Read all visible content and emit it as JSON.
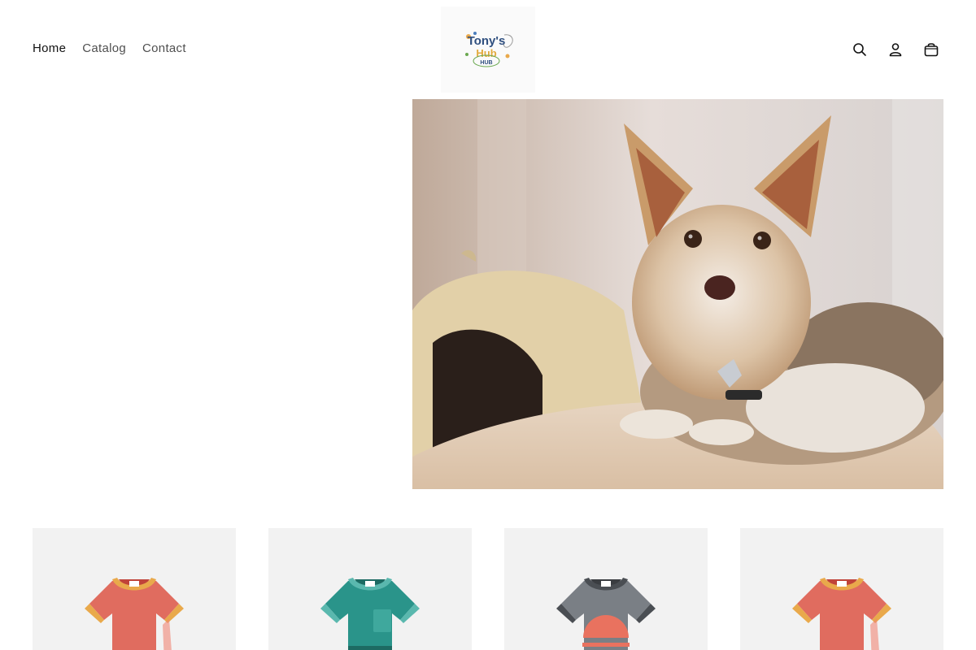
{
  "header": {
    "nav": [
      {
        "label": "Home",
        "active": true
      },
      {
        "label": "Catalog",
        "active": false
      },
      {
        "label": "Contact",
        "active": false
      }
    ],
    "logo": {
      "line1": "Tony's",
      "line2": "Hub",
      "line3": "HUB"
    },
    "icons": [
      "search-icon",
      "account-icon",
      "cart-icon"
    ]
  },
  "hero": {
    "image": "yorkshire-terrier-photo"
  },
  "products": [
    {
      "icon": "tshirt-red",
      "color": "#e06c5f",
      "trim": "#e9a94b"
    },
    {
      "icon": "tshirt-teal",
      "color": "#2a948a",
      "trim": "#5ab8ae"
    },
    {
      "icon": "tshirt-gray",
      "color": "#7a7f85",
      "trim": "#4a4e53"
    },
    {
      "icon": "tshirt-red",
      "color": "#e06c5f",
      "trim": "#e9a94b"
    }
  ]
}
